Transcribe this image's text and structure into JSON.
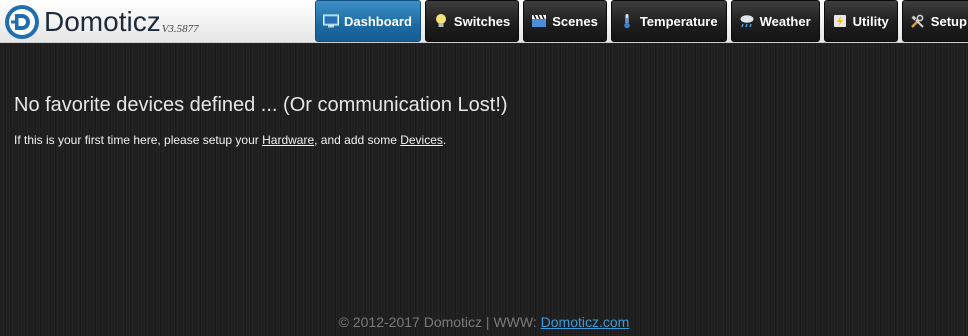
{
  "brand": {
    "name": "Domoticz",
    "version": "V3.5877"
  },
  "nav": {
    "items": [
      {
        "label": "Dashboard",
        "icon": "monitor-icon",
        "active": true
      },
      {
        "label": "Switches",
        "icon": "lightbulb-icon",
        "active": false
      },
      {
        "label": "Scenes",
        "icon": "clapperboard-icon",
        "active": false
      },
      {
        "label": "Temperature",
        "icon": "thermometer-icon",
        "active": false
      },
      {
        "label": "Weather",
        "icon": "rain-cloud-icon",
        "active": false
      },
      {
        "label": "Utility",
        "icon": "lightning-icon",
        "active": false
      },
      {
        "label": "Setup",
        "icon": "tools-icon",
        "active": false
      }
    ]
  },
  "main": {
    "title": "No favorite devices defined ... (Or communication Lost!)",
    "text_prefix": "If this is your first time here, please setup your ",
    "hardware_link": "Hardware",
    "text_middle": ", and add some ",
    "devices_link": "Devices",
    "text_suffix": "."
  },
  "footer": {
    "text": "© 2012-2017 Domoticz | WWW: ",
    "link": "Domoticz.com"
  },
  "colors": {
    "accent": "#1d6aa3",
    "link": "#3a9ad9",
    "background": "#1f1f1f"
  }
}
